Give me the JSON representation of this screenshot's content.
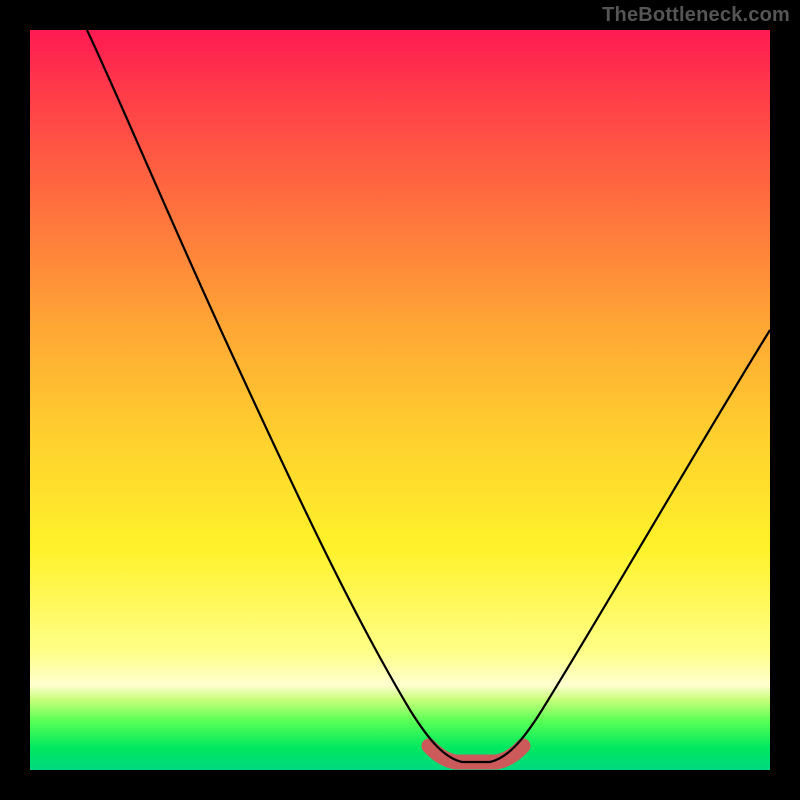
{
  "watermark": "TheBottleneck.com",
  "colors": {
    "frame": "#000000",
    "top": "#ff1a52",
    "mid": "#ffd02e",
    "lower": "#ffff88",
    "green": "#00e860",
    "curve": "#000000",
    "highlight": "#cc5a5a"
  },
  "chart_data": {
    "type": "line",
    "title": "",
    "xlabel": "",
    "ylabel": "",
    "xlim": [
      0,
      100
    ],
    "ylim": [
      0,
      100
    ],
    "series": [
      {
        "name": "bottleneck-curve",
        "x": [
          8,
          15,
          22,
          30,
          37,
          44,
          50,
          55,
          57,
          59,
          61,
          63,
          65,
          70,
          78,
          86,
          94,
          100
        ],
        "y": [
          100,
          86,
          72,
          56,
          40,
          25,
          12,
          4,
          1,
          0,
          0,
          1,
          3,
          9,
          22,
          36,
          50,
          60
        ]
      }
    ],
    "highlight_band": {
      "x_start": 55,
      "x_end": 65,
      "y_level": 0
    },
    "legend": [],
    "annotations": [
      "TheBottleneck.com"
    ]
  }
}
